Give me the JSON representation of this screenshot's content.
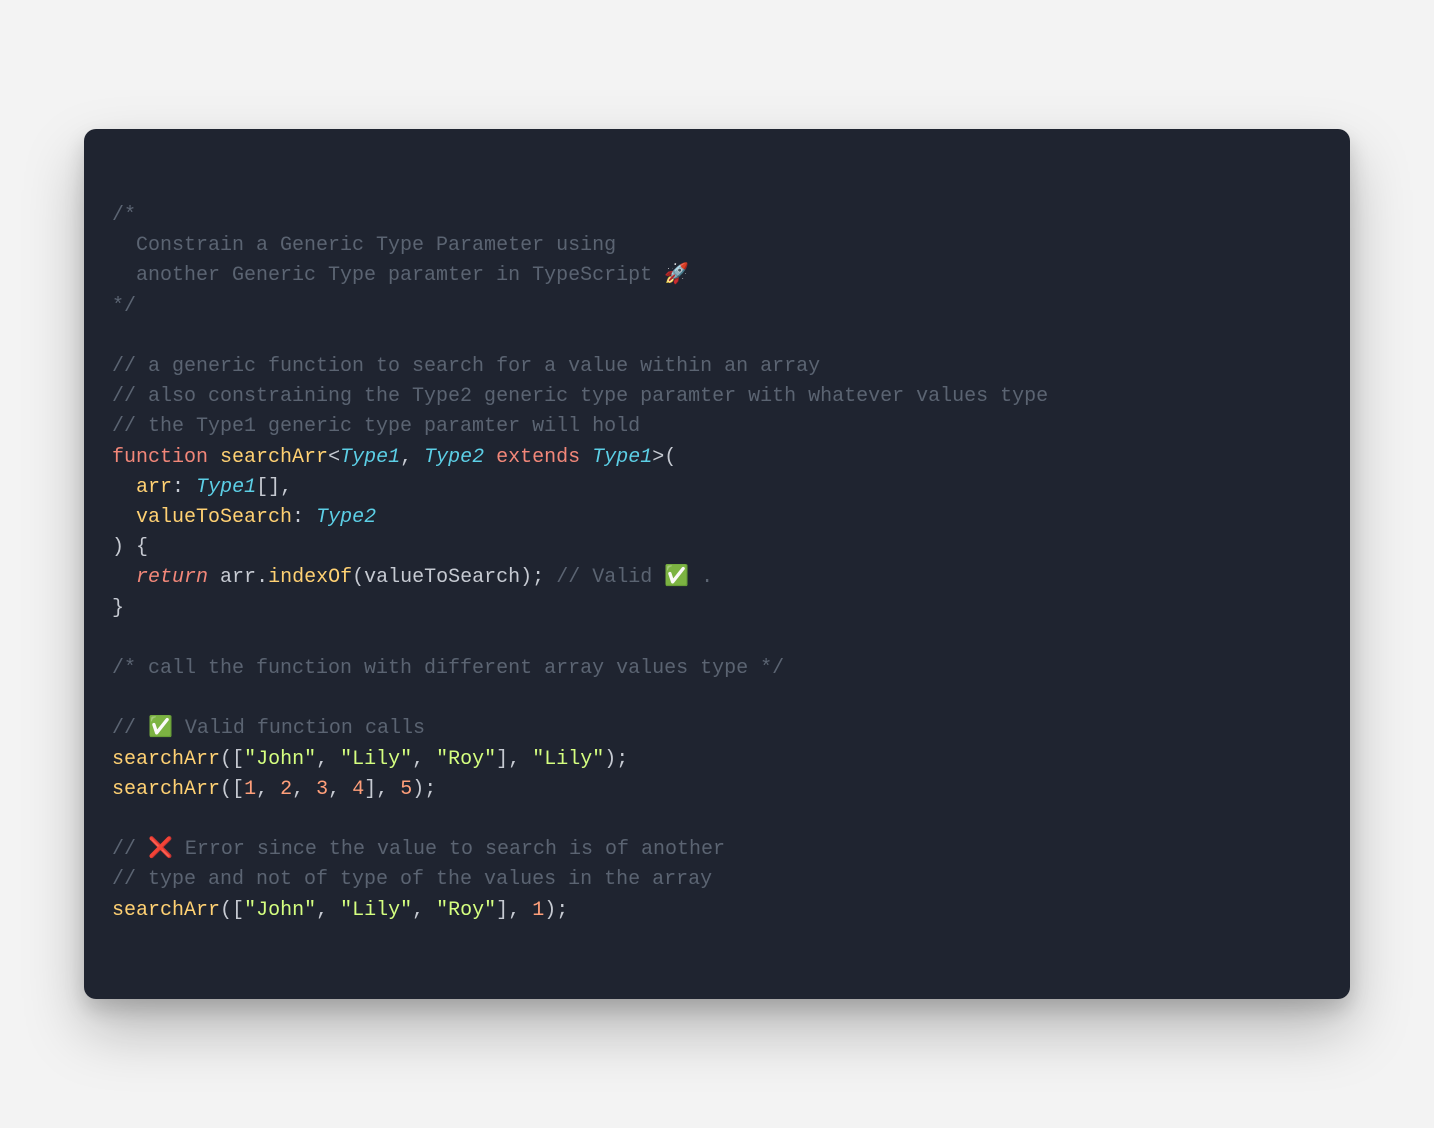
{
  "code": {
    "c1": "/*",
    "c2": "  Constrain a Generic Type Parameter using",
    "c3": "  another Generic Type paramter in TypeScript 🚀",
    "c4": "*/",
    "c5": "// a generic function to search for a value within an array",
    "c6": "// also constraining the Type2 generic type paramter with whatever values type",
    "c7": "// the Type1 generic type paramter will hold",
    "kw_function": "function",
    "fn_name": "searchArr",
    "lt": "<",
    "gt": ">",
    "type1": "Type1",
    "type2": "Type2",
    "kw_extends": "extends",
    "lparen": "(",
    "rparen": ")",
    "param_arr": "arr",
    "colon": ":",
    "brackets": "[]",
    "comma": ",",
    "param_vts": "valueToSearch",
    "lbrace": "{",
    "rbrace": "}",
    "kw_return": "return",
    "id_arr": "arr",
    "dot": ".",
    "method_indexof": "indexOf",
    "id_vts": "valueToSearch",
    "semi": ";",
    "c_valid": "// Valid ✅ .",
    "c8": "/* call the function with different array values type */",
    "c9": "// ✅ Valid function calls",
    "lbrack": "[",
    "rbrack": "]",
    "s_john": "\"John\"",
    "s_lily": "\"Lily\"",
    "s_roy": "\"Roy\"",
    "n1": "1",
    "n2": "2",
    "n3": "3",
    "n4": "4",
    "n5": "5",
    "c10": "// ❌ Error since the value to search is of another",
    "c11": "// type and not of type of the values in the array"
  }
}
